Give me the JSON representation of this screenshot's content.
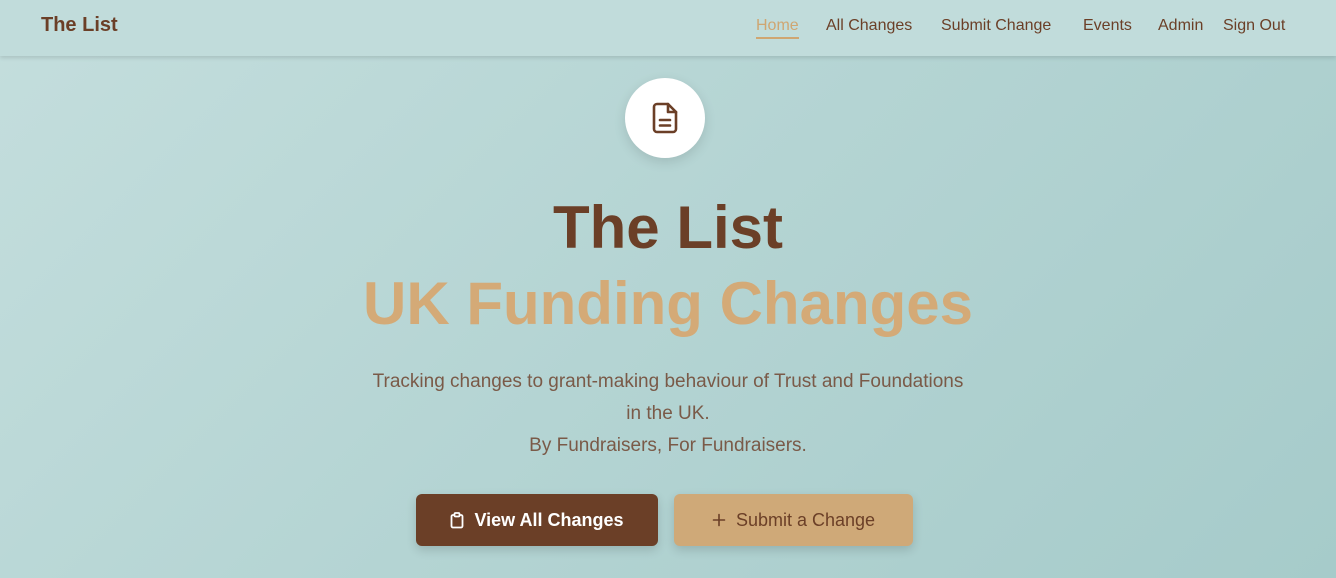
{
  "brand": "The List",
  "nav": {
    "home": "Home",
    "all_changes": "All Changes",
    "submit_change": "Submit Change",
    "events": "Events",
    "admin": "Admin",
    "sign_out": "Sign Out"
  },
  "hero": {
    "icon": "document-icon",
    "title": "The List",
    "subtitle": "UK Funding Changes",
    "desc_line1": "Tracking changes to grant-making behaviour of Trust and Foundations",
    "desc_line2": "in the UK.",
    "desc_line3": "By Fundraisers, For Fundraisers."
  },
  "buttons": {
    "view_all": "View All Changes",
    "view_all_icon": "clipboard-icon",
    "submit": "Submit a Change",
    "submit_icon": "plus-icon"
  },
  "colors": {
    "brand_brown": "#6b3f27",
    "accent_tan": "#cfa672",
    "background": "#b4d4d3"
  }
}
